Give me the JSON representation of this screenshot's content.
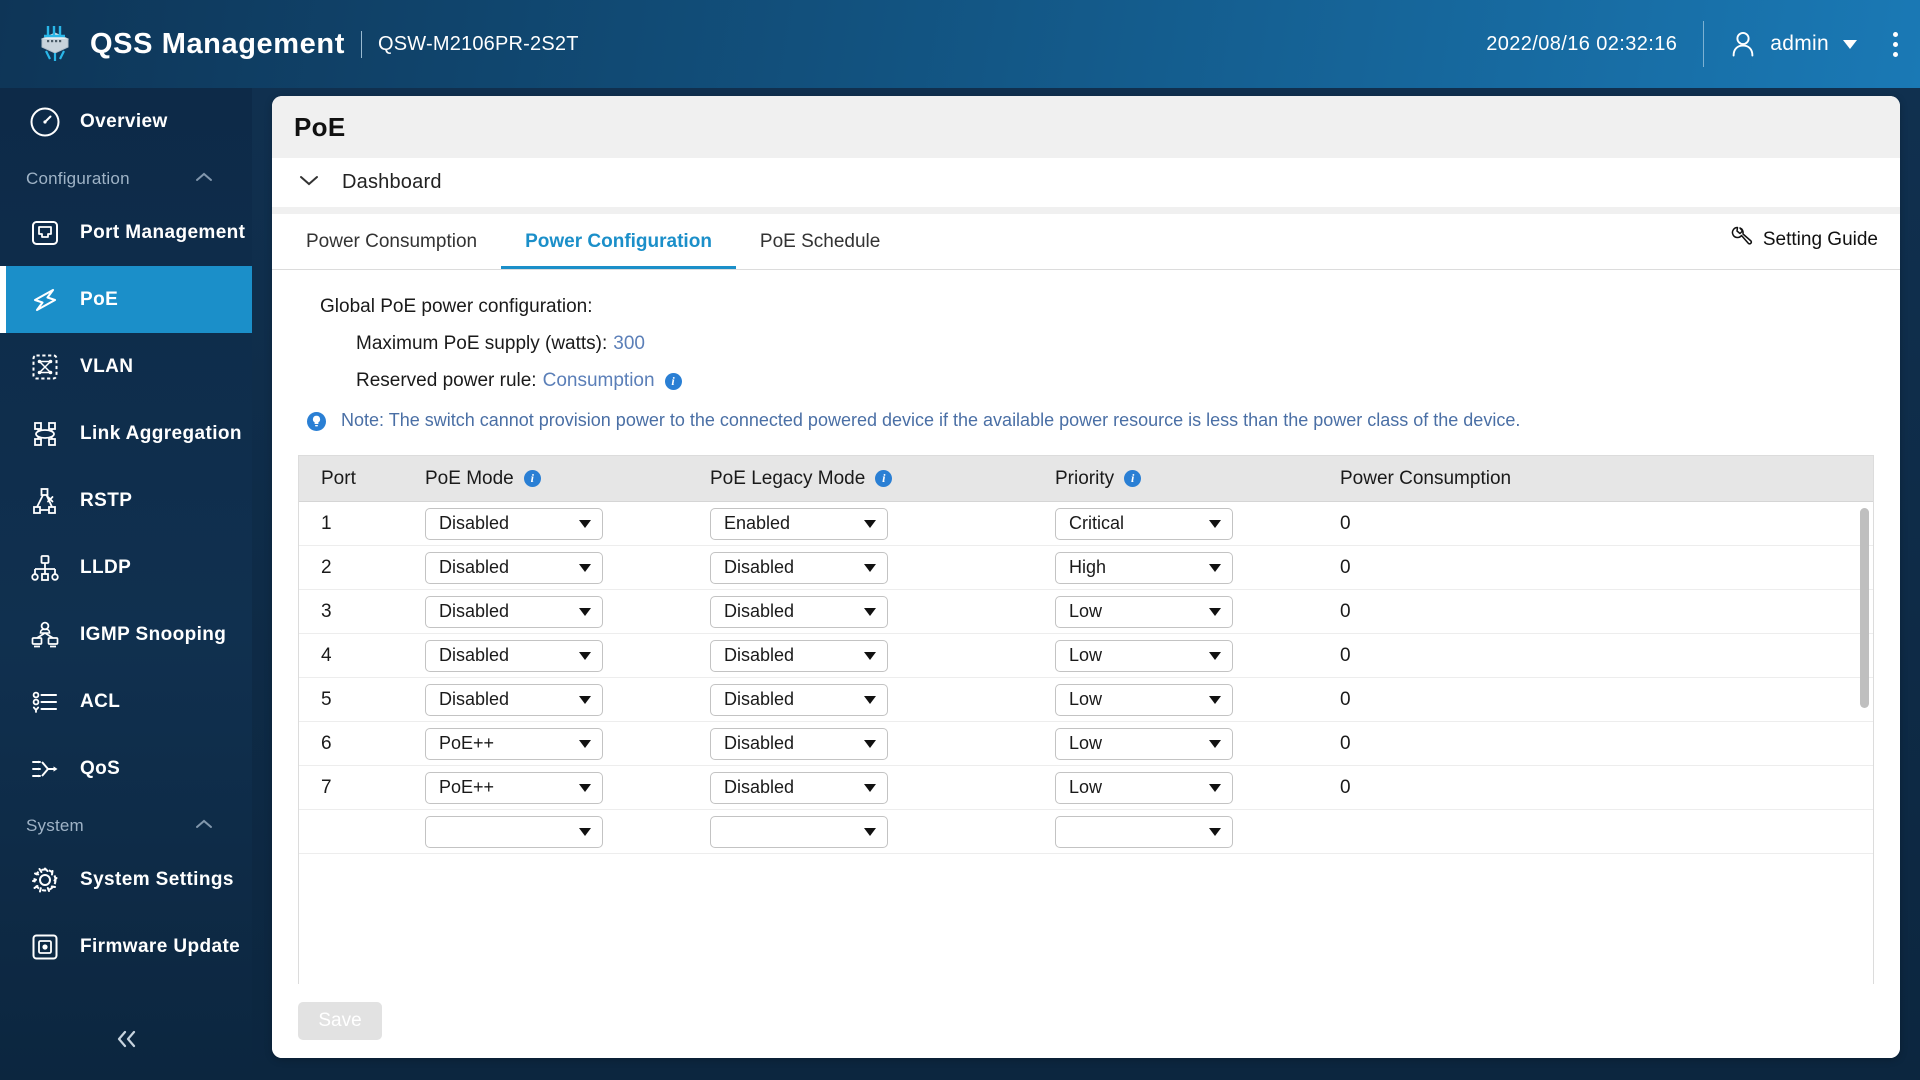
{
  "header": {
    "logo_icon": "switch-device-icon",
    "title": "QSS Management",
    "model": "QSW-M2106PR-2S2T",
    "datetime": "2022/08/16  02:32:16",
    "user_icon": "user-icon",
    "username": "admin",
    "caret_icon": "caret-down-icon",
    "kebab_icon": "more-vertical-icon"
  },
  "sidebar": {
    "items": [
      {
        "label": "Overview",
        "icon": "gauge-icon",
        "type": "item",
        "active": false
      },
      {
        "label": "Configuration",
        "icon": "chevron-up-icon",
        "type": "group"
      },
      {
        "label": "Port Management",
        "icon": "ethernet-port-icon",
        "type": "item",
        "active": false
      },
      {
        "label": "PoE",
        "icon": "lightning-bolt-icon",
        "type": "item",
        "active": true
      },
      {
        "label": "VLAN",
        "icon": "vlan-network-icon",
        "type": "item",
        "active": false
      },
      {
        "label": "Link Aggregation",
        "icon": "link-aggregation-icon",
        "type": "item",
        "active": false
      },
      {
        "label": "RSTP",
        "icon": "spanning-tree-icon",
        "type": "item",
        "active": false
      },
      {
        "label": "LLDP",
        "icon": "topology-tree-icon",
        "type": "item",
        "active": false
      },
      {
        "label": "IGMP Snooping",
        "icon": "multicast-icon",
        "type": "item",
        "active": false
      },
      {
        "label": "ACL",
        "icon": "list-rules-icon",
        "type": "item",
        "active": false
      },
      {
        "label": "QoS",
        "icon": "traffic-priority-icon",
        "type": "item",
        "active": false
      },
      {
        "label": "System",
        "icon": "chevron-up-icon",
        "type": "group"
      },
      {
        "label": "System Settings",
        "icon": "gear-icon",
        "type": "item",
        "active": false
      },
      {
        "label": "Firmware Update",
        "icon": "firmware-chip-icon",
        "type": "item",
        "active": false
      }
    ],
    "collapse_icon": "double-chevron-left-icon"
  },
  "page": {
    "title": "PoE",
    "dashboard_label": "Dashboard",
    "dashboard_chevron_icon": "chevron-down-icon"
  },
  "tabs": [
    {
      "label": "Power Consumption",
      "active": false
    },
    {
      "label": "Power Configuration",
      "active": true
    },
    {
      "label": "PoE Schedule",
      "active": false
    }
  ],
  "setting_guide": {
    "label": "Setting Guide",
    "icon": "wrench-icon"
  },
  "global_config": {
    "heading": "Global PoE power configuration:",
    "max_supply_label": "Maximum PoE supply (watts):",
    "max_supply_value": "300",
    "reserved_rule_label": "Reserved power rule:",
    "reserved_rule_value": "Consumption",
    "reserved_rule_info_icon": "info-icon",
    "note_icon": "lightbulb-icon",
    "note": "Note: The switch cannot provision power to the connected powered device if the available power resource is less than the power class of the device."
  },
  "table": {
    "columns": [
      {
        "key": "port",
        "label": "Port",
        "info": false
      },
      {
        "key": "poe_mode",
        "label": "PoE Mode",
        "info": true,
        "info_icon": "info-icon"
      },
      {
        "key": "poe_legacy_mode",
        "label": "PoE Legacy Mode",
        "info": true,
        "info_icon": "info-icon"
      },
      {
        "key": "priority",
        "label": "Priority",
        "info": true,
        "info_icon": "info-icon"
      },
      {
        "key": "power_consumption",
        "label": "Power Consumption",
        "info": false
      }
    ],
    "rows": [
      {
        "port": "1",
        "poe_mode": "Disabled",
        "poe_legacy_mode": "Enabled",
        "priority": "Critical",
        "power_consumption": "0"
      },
      {
        "port": "2",
        "poe_mode": "Disabled",
        "poe_legacy_mode": "Disabled",
        "priority": "High",
        "power_consumption": "0"
      },
      {
        "port": "3",
        "poe_mode": "Disabled",
        "poe_legacy_mode": "Disabled",
        "priority": "Low",
        "power_consumption": "0"
      },
      {
        "port": "4",
        "poe_mode": "Disabled",
        "poe_legacy_mode": "Disabled",
        "priority": "Low",
        "power_consumption": "0"
      },
      {
        "port": "5",
        "poe_mode": "Disabled",
        "poe_legacy_mode": "Disabled",
        "priority": "Low",
        "power_consumption": "0"
      },
      {
        "port": "6",
        "poe_mode": "PoE++",
        "poe_legacy_mode": "Disabled",
        "priority": "Low",
        "power_consumption": "0"
      },
      {
        "port": "7",
        "poe_mode": "PoE++",
        "poe_legacy_mode": "Disabled",
        "priority": "Low",
        "power_consumption": "0"
      }
    ],
    "dropdown_arrow_icon": "caret-down-icon",
    "scrollbar_name": "table-vertical-scrollbar"
  },
  "footer": {
    "save_label": "Save"
  },
  "colors": {
    "accent": "#1b8fc9",
    "sidebar_bg": "#0d2a48",
    "header_gradient_start": "#0e3557",
    "header_gradient_end": "#1a79b5",
    "link_text": "#5b7fb8",
    "note_text": "#4a6fa5"
  }
}
